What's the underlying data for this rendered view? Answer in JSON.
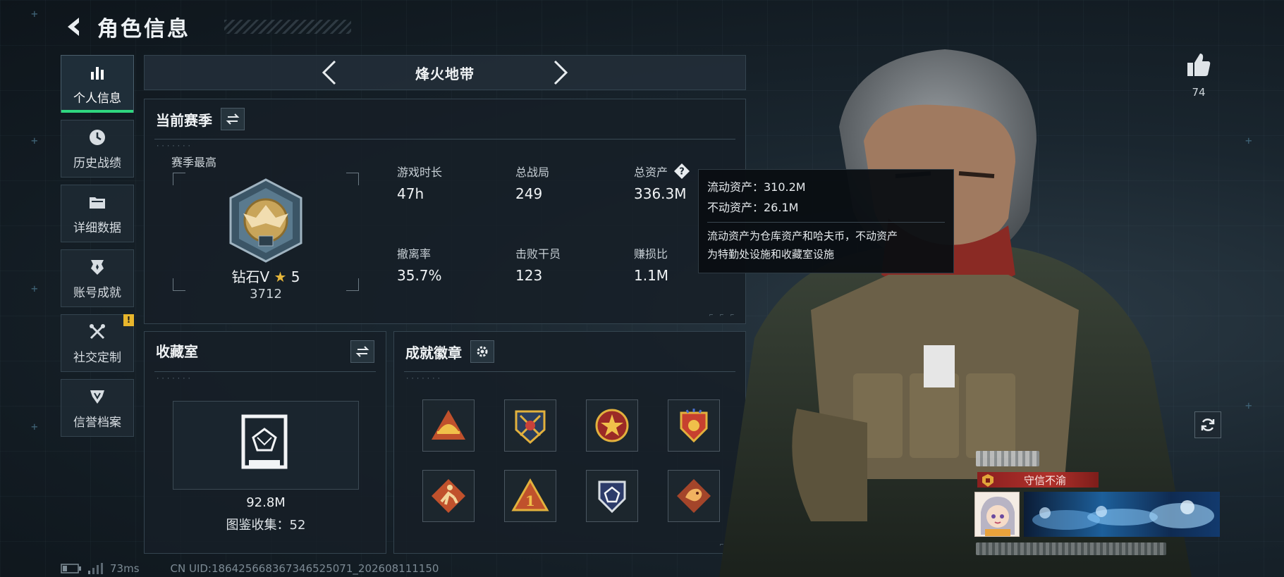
{
  "header": {
    "title": "角色信息"
  },
  "nav": {
    "items": [
      {
        "label": "个人信息",
        "icon": "bar-chart-icon",
        "active": true
      },
      {
        "label": "历史战绩",
        "icon": "clock-icon"
      },
      {
        "label": "详细数据",
        "icon": "folder-icon"
      },
      {
        "label": "账号成就",
        "icon": "trophy-icon"
      },
      {
        "label": "社交定制",
        "icon": "tools-icon",
        "badge": "!"
      },
      {
        "label": "信誉档案",
        "icon": "shield-icon"
      }
    ]
  },
  "mode": {
    "label": "烽火地带"
  },
  "season": {
    "title": "当前赛季",
    "best_label": "赛季最高",
    "rank_name": "钻石V",
    "rank_stars": "5",
    "rank_score": "3712",
    "stats": [
      {
        "label": "游戏时长",
        "value": "47h"
      },
      {
        "label": "总战局",
        "value": "249"
      },
      {
        "label": "总资产",
        "value": "336.3M"
      },
      {
        "label": "撤离率",
        "value": "35.7%"
      },
      {
        "label": "击败干员",
        "value": "123"
      },
      {
        "label": "赚损比",
        "value": "1.1M"
      }
    ]
  },
  "tooltip": {
    "liquid": "流动资产：310.2M",
    "fixed": "不动资产：26.1M",
    "desc_line1": "流动资产为仓库资产和哈夫币，不动资产",
    "desc_line2": "为特勤处设施和收藏室设施"
  },
  "collection": {
    "title": "收藏室",
    "value": "92.8M",
    "count_text": "图鉴收集：52"
  },
  "achievements": {
    "title": "成就徽章"
  },
  "profile": {
    "likes": "74",
    "title_badge": "守信不渝"
  },
  "footer": {
    "ping": "73ms",
    "uid": "CN UID:1864256683673465250​71_202608111150"
  },
  "colors": {
    "accent_green": "#2fd67f",
    "title_red": "#b0312b",
    "star_gold": "#e7b73a"
  }
}
